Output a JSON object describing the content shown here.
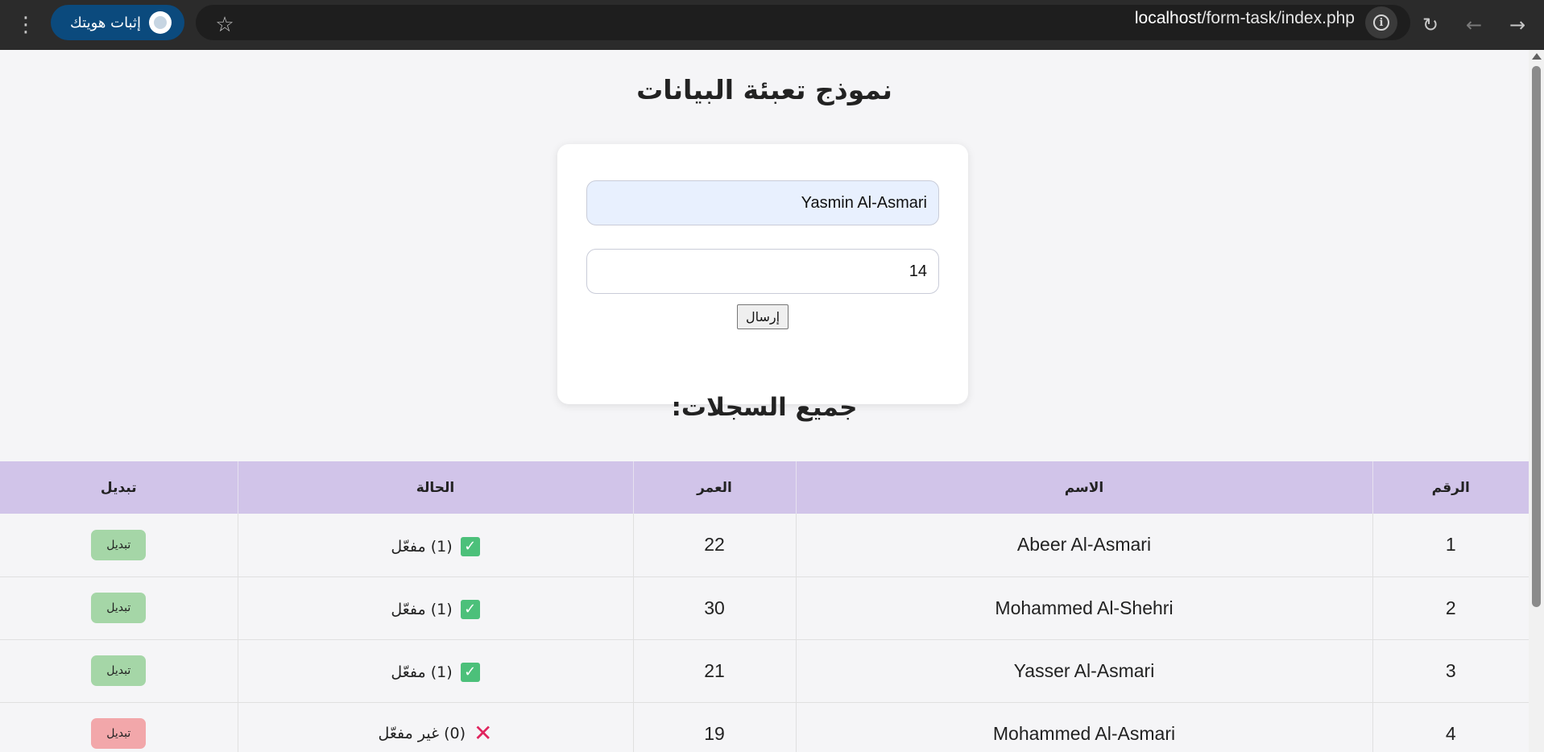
{
  "browser": {
    "profile_label": "إثبات هويتك",
    "url_host": "localhost",
    "url_path": "/form-task/index.php",
    "icons": [
      "menu-dots-icon",
      "star-icon",
      "info-icon",
      "reload-icon",
      "back-arrow-icon",
      "forward-arrow-icon"
    ]
  },
  "page": {
    "title": "نموذج تعبئة البيانات",
    "form": {
      "name_value": "Yasmin Al-Asmari",
      "age_value": "14",
      "submit_label": "إرسال"
    },
    "records_title": "جميع السجلات:",
    "table": {
      "headers": {
        "num": "الرقم",
        "name": "الاسم",
        "age": "العمر",
        "status": "الحالة",
        "toggle": "تبديل"
      },
      "rows": [
        {
          "num": "1",
          "name": "Abeer Al-Asmari",
          "age": "22",
          "status": "(1) مفعّل",
          "active": true,
          "toggle": "تبديل"
        },
        {
          "num": "2",
          "name": "Mohammed Al-Shehri",
          "age": "30",
          "status": "(1) مفعّل",
          "active": true,
          "toggle": "تبديل"
        },
        {
          "num": "3",
          "name": "Yasser Al-Asmari",
          "age": "21",
          "status": "(1) مفعّل",
          "active": true,
          "toggle": "تبديل"
        },
        {
          "num": "4",
          "name": "Mohammed Al-Asmari",
          "age": "19",
          "status": "(0) غير مفعّل",
          "active": false,
          "toggle": "تبديل"
        }
      ]
    }
  },
  "colors": {
    "header_bg": "#d1c4e9",
    "active_toggle": "#a5d6a7",
    "inactive_toggle": "#f2a7aa",
    "profile_pill": "#0b4a7d"
  }
}
